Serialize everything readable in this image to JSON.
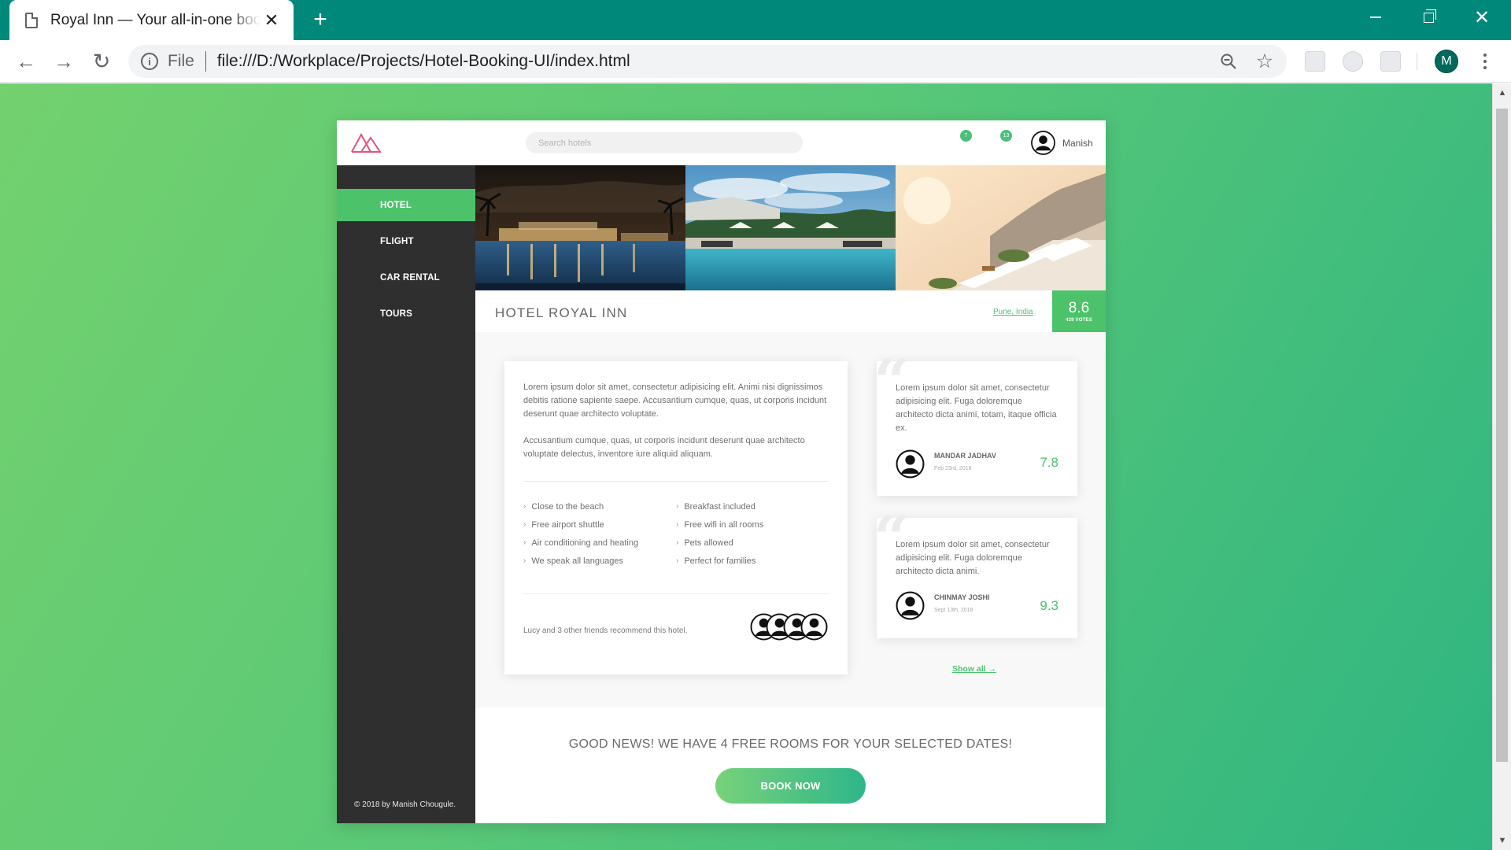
{
  "browser": {
    "tab_title": "Royal Inn — Your all-in-one booking",
    "tab_close": "✕",
    "new_tab": "+",
    "scheme_label": "File",
    "url": "file:///D:/Workplace/Projects/Hotel-Booking-UI/index.html",
    "profile_initial": "M",
    "back_glyph": "←",
    "forward_glyph": "→",
    "reload_glyph": "↻",
    "star_glyph": "☆",
    "info_glyph": "i",
    "close_glyph": "✕",
    "scroll_up_glyph": "▲",
    "scroll_down_glyph": "▼"
  },
  "header": {
    "search_placeholder": "Search hotels",
    "notification_count_a": "7",
    "notification_count_b": "13",
    "user_name": "Manish"
  },
  "sidebar": {
    "items": [
      {
        "label": "HOTEL",
        "active": true
      },
      {
        "label": "FLIGHT",
        "active": false
      },
      {
        "label": "CAR RENTAL",
        "active": false
      },
      {
        "label": "TOURS",
        "active": false
      }
    ],
    "copyright": "© 2018 by Manish Chougule."
  },
  "hotel": {
    "name": "HOTEL ROYAL INN",
    "location": "Pune, India",
    "rating": "8.6",
    "votes": "429 VOTES"
  },
  "description": {
    "paragraph_1": "Lorem ipsum dolor sit amet, consectetur adipisicing elit. Animi nisi dignissimos debitis ratione sapiente saepe. Accusantium cumque, quas, ut corporis incidunt deserunt quae architecto voluptate.",
    "paragraph_2": "Accusantium cumque, quas, ut corporis incidunt deserunt quae architecto voluptate delectus, inventore iure aliquid aliquam.",
    "amenity_icon": "›",
    "amenities": [
      "Close to the beach",
      "Breakfast included",
      "Free airport shuttle",
      "Free wifi in all rooms",
      "Air conditioning and heating",
      "Pets allowed",
      "We speak all languages",
      "Perfect for families"
    ],
    "recommendation": "Lucy and 3 other friends recommend this hotel."
  },
  "reviews": [
    {
      "text": "Lorem ipsum dolor sit amet, consectetur adipisicing elit. Fuga doloremque architecto dicta animi, totam, itaque officia ex.",
      "name": "MANDAR JADHAV",
      "date": "Feb 23rd, 2018",
      "score": "7.8"
    },
    {
      "text": "Lorem ipsum dolor sit amet, consectetur adipisicing elit. Fuga doloremque architecto dicta animi.",
      "name": "CHINMAY JOSHI",
      "date": "Sept 13th, 2018",
      "score": "9.3"
    }
  ],
  "quote_glyph": "“",
  "show_all": "Show all →",
  "booking": {
    "news": "GOOD NEWS! WE HAVE 4 FREE ROOMS FOR YOUR SELECTED DATES!",
    "button": "BOOK NOW"
  },
  "colors": {
    "accent": "#4cc36b",
    "sidebar": "#2f2f2f",
    "browser_frame": "#00897b",
    "logo": "#e5517a"
  }
}
